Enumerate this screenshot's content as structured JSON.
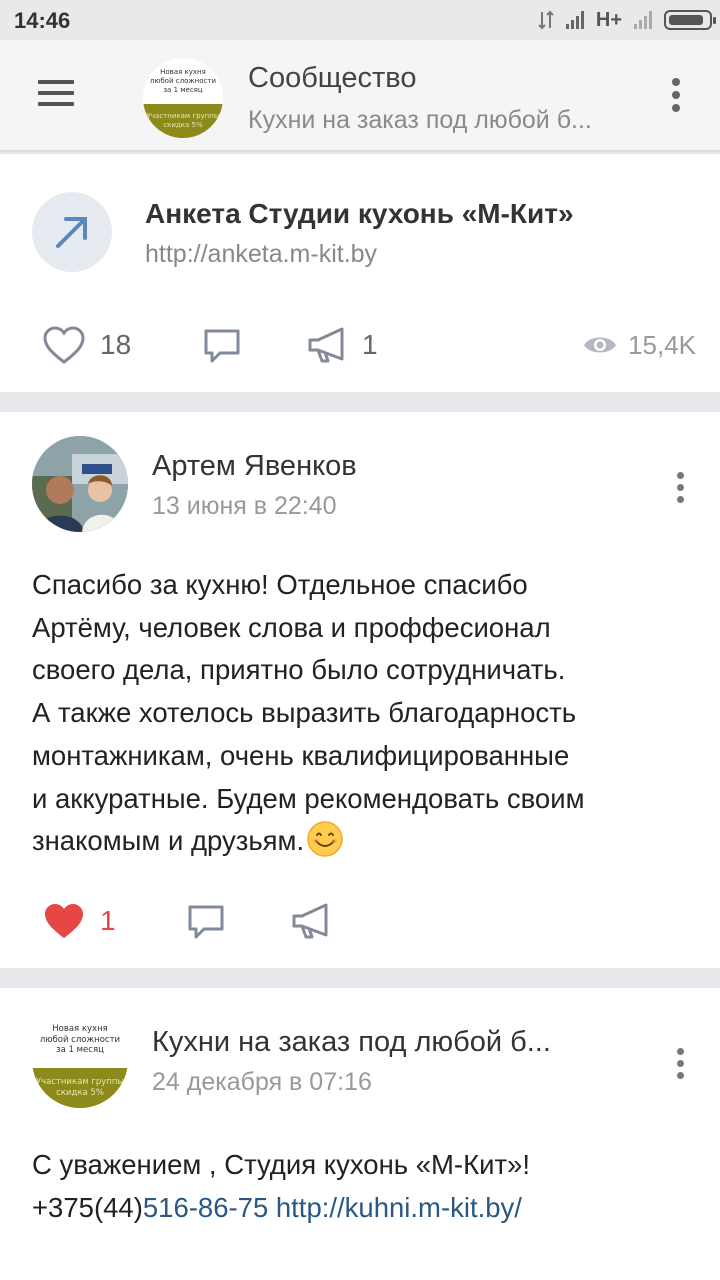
{
  "status_bar": {
    "time": "14:46",
    "network": "H+"
  },
  "header": {
    "title": "Сообщество",
    "subtitle": "Кухни на заказ под любой б...",
    "logo": {
      "line1": "Новая кухня",
      "line2": "любой сложности",
      "line3": "за 1 месяц",
      "line4": "Участникам группы",
      "line5": "скидка 5%"
    }
  },
  "link_post": {
    "title": "Анкета Студии кухонь «М-Кит»",
    "url": "http://anketa.m-kit.by",
    "likes": "18",
    "reposts": "1",
    "views": "15,4K"
  },
  "review_post": {
    "author": "Артем Явенков",
    "date": "13 июня в 22:40",
    "text": "Спасибо за кухню! Отдельное спасибо\nАртёму, человек слова и проффесионал\nсвоего дела, приятно было сотрудничать.\nА также хотелось выразить благодарность\nмонтажникам, очень квалифицированные\nи аккуратные. Будем рекомендовать своим\nзнакомым и друзьям.",
    "likes": "1"
  },
  "reply_post": {
    "author": "Кухни на заказ под любой б...",
    "date": "24 декабря в 07:16",
    "line1": "С уважением , Студия кухонь «М-Кит»!",
    "phone_prefix": "+375(44)",
    "phone_link": "516-86-75",
    "site_link": "http://kuhni.m-kit.by/"
  },
  "colors": {
    "like_active": "#e64646",
    "link": "#2a5885",
    "logo_green": "#8c8a1a"
  }
}
